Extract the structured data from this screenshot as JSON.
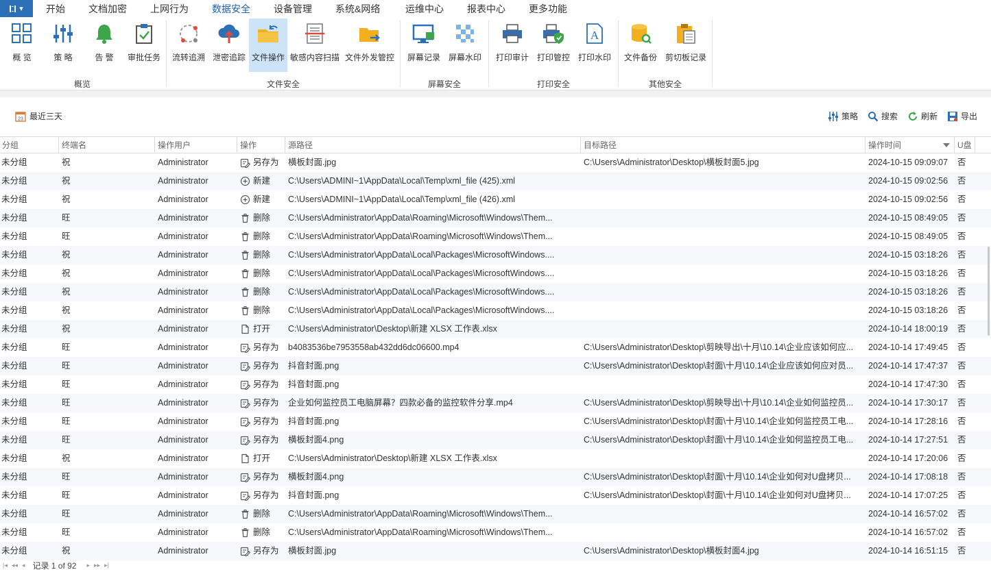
{
  "menu": {
    "items": [
      "开始",
      "文档加密",
      "上网行为",
      "数据安全",
      "设备管理",
      "系统&网络",
      "运维中心",
      "报表中心",
      "更多功能"
    ],
    "active_index": 3
  },
  "ribbon": {
    "buttons": [
      {
        "label": "概  览",
        "icon": "overview-grid-icon"
      },
      {
        "label": "策  略",
        "icon": "policy-sliders-icon"
      },
      {
        "label": "告  警",
        "icon": "alarm-bell-icon"
      },
      {
        "label": "审批任务",
        "icon": "approval-clipboard-icon"
      },
      {
        "label": "流转追溯",
        "icon": "flow-trace-icon"
      },
      {
        "label": "泄密追踪",
        "icon": "leak-cloud-icon"
      },
      {
        "label": "文件操作",
        "icon": "file-folder-icon"
      },
      {
        "label": "敏感内容扫描",
        "icon": "sensitive-scan-icon"
      },
      {
        "label": "文件外发管控",
        "icon": "file-send-icon"
      },
      {
        "label": "屏幕记录",
        "icon": "screen-record-icon"
      },
      {
        "label": "屏幕水印",
        "icon": "screen-watermark-icon"
      },
      {
        "label": "打印审计",
        "icon": "print-audit-icon"
      },
      {
        "label": "打印管控",
        "icon": "print-control-icon"
      },
      {
        "label": "打印水印",
        "icon": "print-watermark-icon"
      },
      {
        "label": "文件备份",
        "icon": "file-backup-icon"
      },
      {
        "label": "剪切板记录",
        "icon": "clipboard-record-icon"
      }
    ],
    "selected": "文件操作",
    "groups": [
      "概览",
      "文件安全",
      "屏幕安全",
      "打印安全",
      "其他安全"
    ]
  },
  "toolbar": {
    "date_filter": "最近三天",
    "date_icon_text": "23",
    "policy": "策略",
    "search": "搜索",
    "refresh": "刷新",
    "export": "导出"
  },
  "table": {
    "columns": [
      "分组",
      "终端名",
      "操作用户",
      "操作",
      "源路径",
      "目标路径",
      "操作时间",
      "U盘"
    ],
    "rows": [
      [
        "未分组",
        "祝",
        "Administrator",
        "另存为",
        "横板封面.jpg",
        "C:\\Users\\Administrator\\Desktop\\横板封面5.jpg",
        "2024-10-15 09:09:07",
        "否"
      ],
      [
        "未分组",
        "祝",
        "Administrator",
        "新建",
        "C:\\Users\\ADMINI~1\\AppData\\Local\\Temp\\xml_file (425).xml",
        "",
        "2024-10-15 09:02:56",
        "否"
      ],
      [
        "未分组",
        "祝",
        "Administrator",
        "新建",
        "C:\\Users\\ADMINI~1\\AppData\\Local\\Temp\\xml_file (426).xml",
        "",
        "2024-10-15 09:02:56",
        "否"
      ],
      [
        "未分组",
        "旺",
        "Administrator",
        "删除",
        "C:\\Users\\Administrator\\AppData\\Roaming\\Microsoft\\Windows\\Them...",
        "",
        "2024-10-15 08:49:05",
        "否"
      ],
      [
        "未分组",
        "旺",
        "Administrator",
        "删除",
        "C:\\Users\\Administrator\\AppData\\Roaming\\Microsoft\\Windows\\Them...",
        "",
        "2024-10-15 08:49:05",
        "否"
      ],
      [
        "未分组",
        "祝",
        "Administrator",
        "删除",
        "C:\\Users\\Administrator\\AppData\\Local\\Packages\\MicrosoftWindows....",
        "",
        "2024-10-15 03:18:26",
        "否"
      ],
      [
        "未分组",
        "祝",
        "Administrator",
        "删除",
        "C:\\Users\\Administrator\\AppData\\Local\\Packages\\MicrosoftWindows....",
        "",
        "2024-10-15 03:18:26",
        "否"
      ],
      [
        "未分组",
        "祝",
        "Administrator",
        "删除",
        "C:\\Users\\Administrator\\AppData\\Local\\Packages\\MicrosoftWindows....",
        "",
        "2024-10-15 03:18:26",
        "否"
      ],
      [
        "未分组",
        "祝",
        "Administrator",
        "删除",
        "C:\\Users\\Administrator\\AppData\\Local\\Packages\\MicrosoftWindows....",
        "",
        "2024-10-15 03:18:26",
        "否"
      ],
      [
        "未分组",
        "祝",
        "Administrator",
        "打开",
        "C:\\Users\\Administrator\\Desktop\\新建 XLSX 工作表.xlsx",
        "",
        "2024-10-14 18:00:19",
        "否"
      ],
      [
        "未分组",
        "旺",
        "Administrator",
        "另存为",
        "b4083536be7953558ab432dd6dc06600.mp4",
        "C:\\Users\\Administrator\\Desktop\\剪映导出\\十月\\10.14\\企业应该如何应...",
        "2024-10-14 17:49:45",
        "否"
      ],
      [
        "未分组",
        "旺",
        "Administrator",
        "另存为",
        "抖音封面.png",
        "C:\\Users\\Administrator\\Desktop\\封面\\十月\\10.14\\企业应该如何应对员...",
        "2024-10-14 17:47:37",
        "否"
      ],
      [
        "未分组",
        "旺",
        "Administrator",
        "另存为",
        "抖音封面.png",
        "",
        "2024-10-14 17:47:30",
        "否"
      ],
      [
        "未分组",
        "旺",
        "Administrator",
        "另存为",
        "企业如何监控员工电脑屏幕？四款必备的监控软件分享.mp4",
        "C:\\Users\\Administrator\\Desktop\\剪映导出\\十月\\10.14\\企业如何监控员...",
        "2024-10-14 17:30:17",
        "否"
      ],
      [
        "未分组",
        "旺",
        "Administrator",
        "另存为",
        "抖音封面.png",
        "C:\\Users\\Administrator\\Desktop\\封面\\十月\\10.14\\企业如何监控员工电...",
        "2024-10-14 17:28:16",
        "否"
      ],
      [
        "未分组",
        "旺",
        "Administrator",
        "另存为",
        "横板封面4.png",
        "C:\\Users\\Administrator\\Desktop\\封面\\十月\\10.14\\企业如何监控员工电...",
        "2024-10-14 17:27:51",
        "否"
      ],
      [
        "未分组",
        "祝",
        "Administrator",
        "打开",
        "C:\\Users\\Administrator\\Desktop\\新建 XLSX 工作表.xlsx",
        "",
        "2024-10-14 17:20:06",
        "否"
      ],
      [
        "未分组",
        "旺",
        "Administrator",
        "另存为",
        "横板封面4.png",
        "C:\\Users\\Administrator\\Desktop\\封面\\十月\\10.14\\企业如何对U盘拷贝...",
        "2024-10-14 17:08:18",
        "否"
      ],
      [
        "未分组",
        "旺",
        "Administrator",
        "另存为",
        "抖音封面.png",
        "C:\\Users\\Administrator\\Desktop\\封面\\十月\\10.14\\企业如何对U盘拷贝...",
        "2024-10-14 17:07:25",
        "否"
      ],
      [
        "未分组",
        "旺",
        "Administrator",
        "删除",
        "C:\\Users\\Administrator\\AppData\\Roaming\\Microsoft\\Windows\\Them...",
        "",
        "2024-10-14 16:57:02",
        "否"
      ],
      [
        "未分组",
        "旺",
        "Administrator",
        "删除",
        "C:\\Users\\Administrator\\AppData\\Roaming\\Microsoft\\Windows\\Them...",
        "",
        "2024-10-14 16:57:02",
        "否"
      ],
      [
        "未分组",
        "祝",
        "Administrator",
        "另存为",
        "横板封面.jpg",
        "C:\\Users\\Administrator\\Desktop\\横板封面4.jpg",
        "2024-10-14 16:51:15",
        "否"
      ]
    ]
  },
  "pager": {
    "text": "记录 1 of 92"
  },
  "colors": {
    "accent": "#2b6fb6",
    "selected_bg": "#cde3f7",
    "alt_row": "#f6f8fb"
  }
}
